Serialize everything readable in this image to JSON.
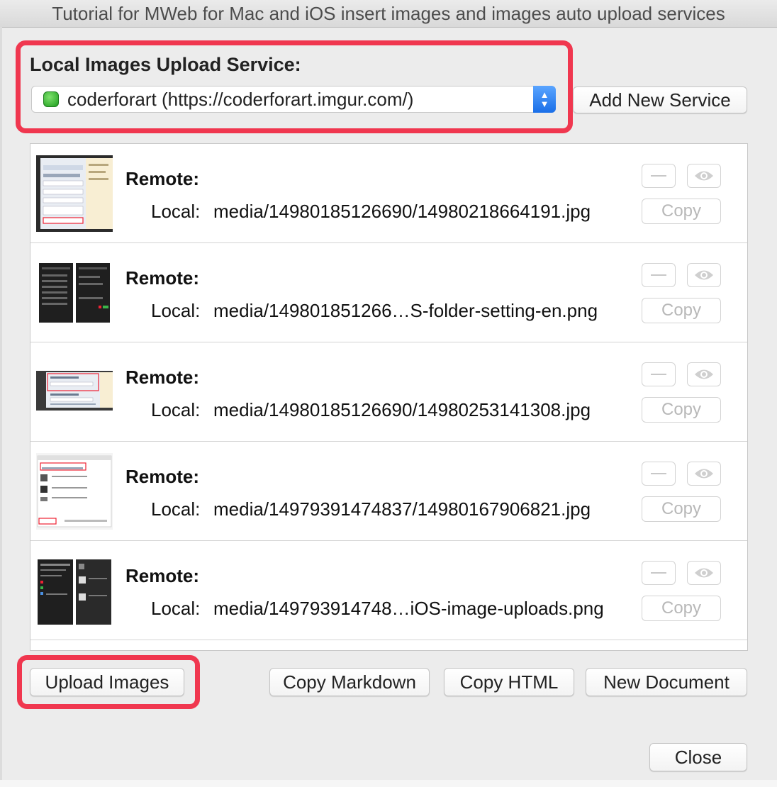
{
  "window": {
    "title": "Tutorial for MWeb for Mac and iOS insert images and images auto upload services"
  },
  "service": {
    "label": "Local Images Upload Service:",
    "selected": "coderforart (https://coderforart.imgur.com/)",
    "status_icon": "green-status-icon",
    "add_button": "Add New Service"
  },
  "images": [
    {
      "remote_label": "Remote:",
      "local_label": "Local:",
      "local_path": "media/14980185126690/14980218664191.jpg",
      "copy_label": "Copy",
      "thumb_icon": "settings-screenshot-thumbnail"
    },
    {
      "remote_label": "Remote:",
      "local_label": "Local:",
      "local_path": "media/149801851266…S-folder-setting-en.png",
      "copy_label": "Copy",
      "thumb_icon": "ios-folder-setting-thumbnail"
    },
    {
      "remote_label": "Remote:",
      "local_label": "Local:",
      "local_path": "media/14980185126690/14980253141308.jpg",
      "copy_label": "Copy",
      "thumb_icon": "media-folder-name-thumbnail"
    },
    {
      "remote_label": "Remote:",
      "local_label": "Local:",
      "local_path": "media/14979391474837/14980167906821.jpg",
      "copy_label": "Copy",
      "thumb_icon": "upload-dialog-thumbnail"
    },
    {
      "remote_label": "Remote:",
      "local_label": "Local:",
      "local_path": "media/149793914748…iOS-image-uploads.png",
      "copy_label": "Copy",
      "thumb_icon": "ios-image-uploads-thumbnail"
    }
  ],
  "actions": {
    "upload": "Upload Images",
    "copy_markdown": "Copy Markdown",
    "copy_html": "Copy HTML",
    "new_document": "New Document",
    "close": "Close"
  },
  "colors": {
    "highlight": "#f0374f",
    "select_accent": "#1a6fe8",
    "status_green": "#1e9e1e"
  }
}
